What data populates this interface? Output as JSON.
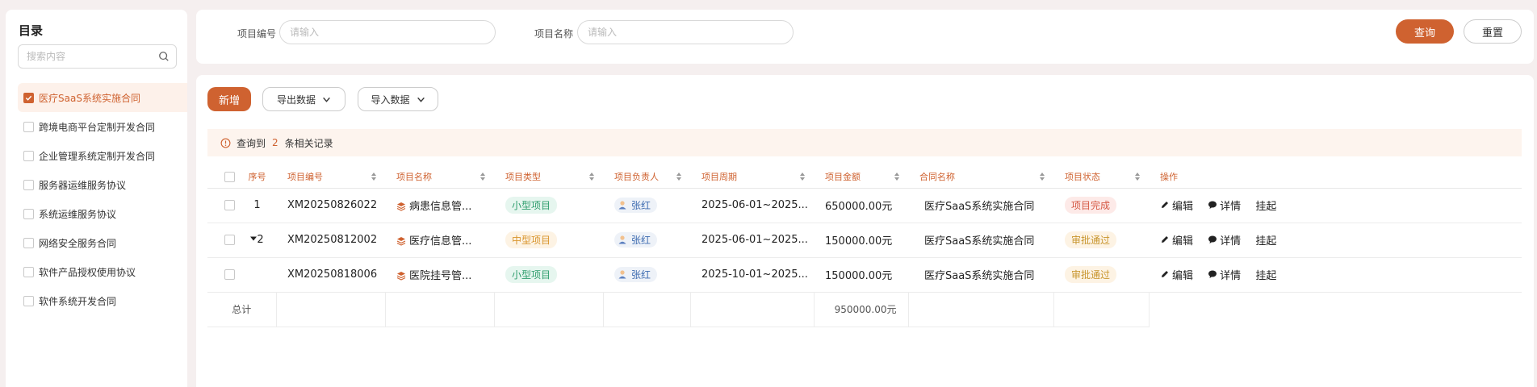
{
  "sidebar": {
    "title": "目录",
    "search_placeholder": "搜索内容",
    "items": [
      {
        "label": "医疗SaaS系统实施合同",
        "checked": true
      },
      {
        "label": "跨境电商平台定制开发合同",
        "checked": false
      },
      {
        "label": "企业管理系统定制开发合同",
        "checked": false
      },
      {
        "label": "服务器运维服务协议",
        "checked": false
      },
      {
        "label": "系统运维服务协议",
        "checked": false
      },
      {
        "label": "网络安全服务合同",
        "checked": false
      },
      {
        "label": "软件产品授权使用协议",
        "checked": false
      },
      {
        "label": "软件系统开发合同",
        "checked": false
      }
    ]
  },
  "filter": {
    "code_label": "项目编号",
    "code_placeholder": "请输入",
    "name_label": "项目名称",
    "name_placeholder": "请输入",
    "query_label": "查询",
    "reset_label": "重置"
  },
  "toolbar": {
    "new_label": "新增",
    "export_label": "导出数据",
    "import_label": "导入数据"
  },
  "alert": {
    "prefix": "查询到",
    "count": "2",
    "suffix": "条相关记录"
  },
  "table": {
    "headers": {
      "index": "序号",
      "code": "项目编号",
      "name": "项目名称",
      "type": "项目类型",
      "owner": "项目负责人",
      "period": "项目周期",
      "amount": "项目金额",
      "contract": "合同名称",
      "status": "项目状态",
      "actions": "操作"
    },
    "rows": [
      {
        "index": "1",
        "code": "XM20250826022",
        "name": "病患信息管...",
        "type": "小型项目",
        "owner": "张红",
        "period": "2025-06-01~2025...",
        "amount": "650000.00元",
        "contract": "医疗SaaS系统实施合同",
        "status": "项目完成"
      },
      {
        "index": "2",
        "code": "XM20250812002",
        "name": "医疗信息管...",
        "type": "中型项目",
        "owner": "张红",
        "period": "2025-06-01~2025...",
        "amount": "150000.00元",
        "contract": "医疗SaaS系统实施合同",
        "status": "审批通过"
      },
      {
        "index": "",
        "code": "XM20250818006",
        "name": "医院挂号管...",
        "type": "小型项目",
        "owner": "张红",
        "period": "2025-10-01~2025...",
        "amount": "150000.00元",
        "contract": "医疗SaaS系统实施合同",
        "status": "审批通过"
      }
    ],
    "action_labels": {
      "edit": "编辑",
      "detail": "详情",
      "suspend": "挂起"
    },
    "total_label": "总计",
    "total_amount": "950000.00元"
  },
  "colors": {
    "accent": "#cf6230"
  }
}
